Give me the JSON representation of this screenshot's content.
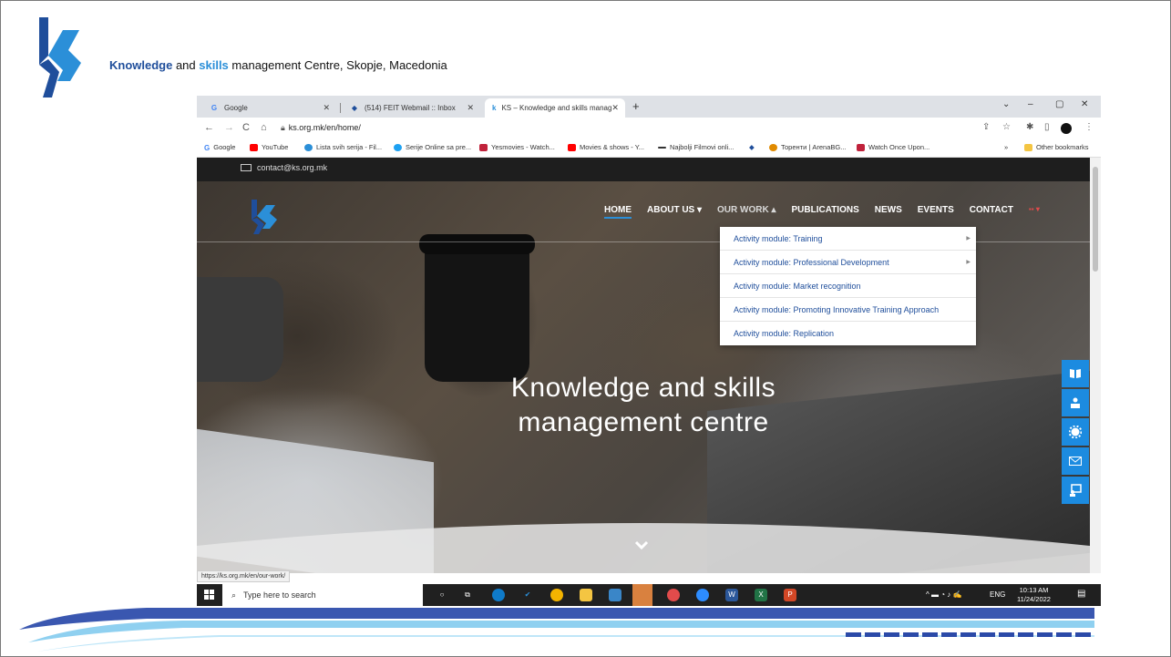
{
  "slide": {
    "title_part1": "Knowledge",
    "title_part2": " and ",
    "title_part3": "skills",
    "title_part4": " management Centre, Skopje, Macedonia"
  },
  "browser": {
    "tabs": [
      {
        "label": "Google",
        "icon": "google-icon"
      },
      {
        "label": "(514) FEIT Webmail :: Inbox",
        "icon": "webmail-icon"
      },
      {
        "label": "KS – Knowledge and skills manag",
        "icon": "ks-icon"
      }
    ],
    "new_tab": "+",
    "window_controls": [
      "⌄",
      "–",
      "▢",
      "✕"
    ],
    "url": "ks.org.mk/en/home/",
    "bookmarks": [
      {
        "label": "Google",
        "color": "#4285f4"
      },
      {
        "label": "YouTube",
        "color": "#ff0000"
      },
      {
        "label": "Lista svih serija - Fil...",
        "color": "#2b8fd8"
      },
      {
        "label": "Serije Online sa pre...",
        "color": "#1da1f2"
      },
      {
        "label": "Yesmovies - Watch...",
        "color": "#c0223b"
      },
      {
        "label": "Movies & shows - Y...",
        "color": "#ff0000"
      },
      {
        "label": "Najbolji Filmovi onli...",
        "color": "#333333"
      },
      {
        "label": "Торенти | ArenaBG...",
        "color": "#e08a00"
      },
      {
        "label": "Watch Once Upon...",
        "color": "#c0223b"
      }
    ],
    "bookmarks_more": "»",
    "other_bookmarks": "Other bookmarks",
    "status_url": "https://ks.org.mk/en/our-work/"
  },
  "site": {
    "contact_email": "contact@ks.org.mk",
    "menu": [
      {
        "label": "HOME"
      },
      {
        "label": "ABOUT US ▾"
      },
      {
        "label": "OUR WORK ▴"
      },
      {
        "label": "PUBLICATIONS"
      },
      {
        "label": "NEWS"
      },
      {
        "label": "EVENTS"
      },
      {
        "label": "CONTACT"
      },
      {
        "label": "▪▪ ▾"
      }
    ],
    "dropdown": [
      {
        "label": "Activity module: Training",
        "submenu": true
      },
      {
        "label": "Activity module: Professional Development",
        "submenu": true
      },
      {
        "label": "Activity module: Market recognition",
        "submenu": false
      },
      {
        "label": "Activity module: Promoting Innovative Training Approach",
        "submenu": false
      },
      {
        "label": "Activity module: Replication",
        "submenu": false
      }
    ],
    "hero_line1": "Knowledge and skills",
    "hero_line2": "management centre",
    "side_buttons": [
      "book-icon",
      "user-group-icon",
      "gear-icon",
      "envelope-icon",
      "presentation-icon"
    ]
  },
  "taskbar": {
    "search_placeholder": "Type here to search",
    "language": "ENG",
    "time": "10:13 AM",
    "date": "11/24/2022"
  },
  "colors": {
    "brand_blue": "#1f4e9b",
    "accent_blue": "#2b8fd8",
    "side_button_blue": "#1c8be0"
  }
}
